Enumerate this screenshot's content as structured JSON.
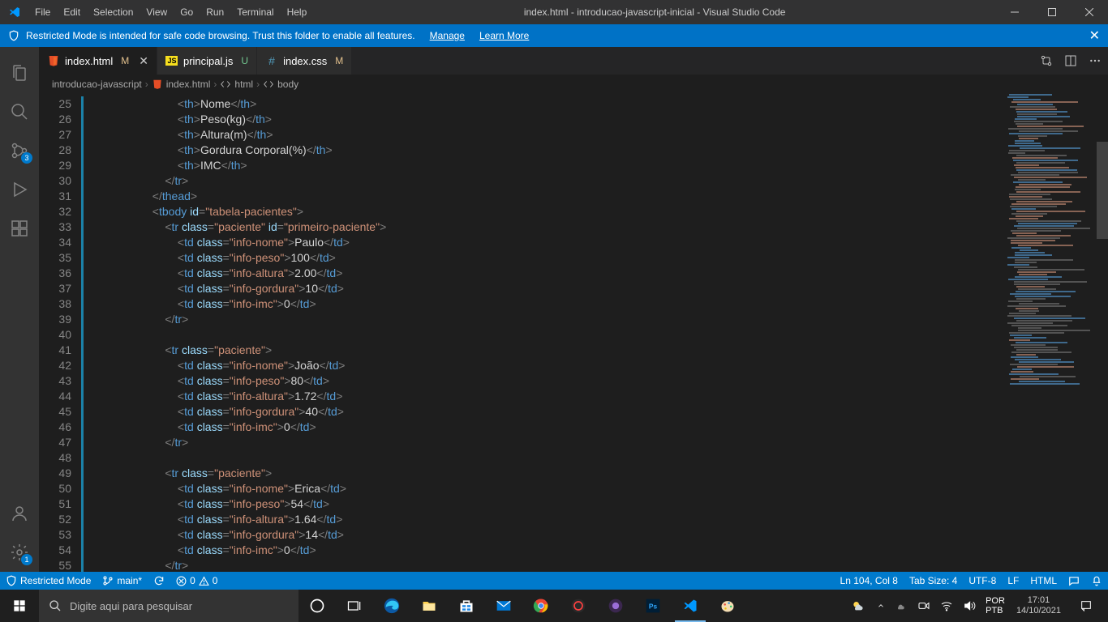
{
  "titlebar": {
    "menus": [
      "File",
      "Edit",
      "Selection",
      "View",
      "Go",
      "Run",
      "Terminal",
      "Help"
    ],
    "title": "index.html - introducao-javascript-inicial - Visual Studio Code"
  },
  "notification": {
    "text": "Restricted Mode is intended for safe code browsing. Trust this folder to enable all features.",
    "manage": "Manage",
    "learn_more": "Learn More"
  },
  "activitybar": {
    "scm_badge": "3",
    "manage_badge": "1"
  },
  "tabs": [
    {
      "icon": "html",
      "label": "index.html",
      "mod": "M",
      "mod_class": "m",
      "active": true,
      "close": true
    },
    {
      "icon": "js",
      "label": "principal.js",
      "mod": "U",
      "mod_class": "u",
      "active": false,
      "close": false
    },
    {
      "icon": "css",
      "label": "index.css",
      "mod": "M",
      "mod_class": "m",
      "active": false,
      "close": false
    }
  ],
  "breadcrumbs": {
    "items": [
      {
        "icon": "",
        "label": "introducao-javascript"
      },
      {
        "icon": "html",
        "label": "index.html"
      },
      {
        "icon": "sym",
        "label": "html"
      },
      {
        "icon": "sym",
        "label": "body"
      }
    ]
  },
  "gutter_start": 25,
  "gutter_end": 55,
  "code_lines": [
    {
      "indent": 7,
      "html": "<span class='t-tag'>&lt;</span><span class='t-elem'>th</span><span class='t-tag'>&gt;</span><span class='t-text'>Nome</span><span class='t-tag'>&lt;/</span><span class='t-elem'>th</span><span class='t-tag'>&gt;</span>",
      "m": true
    },
    {
      "indent": 7,
      "html": "<span class='t-tag'>&lt;</span><span class='t-elem'>th</span><span class='t-tag'>&gt;</span><span class='t-text'>Peso(kg)</span><span class='t-tag'>&lt;/</span><span class='t-elem'>th</span><span class='t-tag'>&gt;</span>",
      "m": true
    },
    {
      "indent": 7,
      "html": "<span class='t-tag'>&lt;</span><span class='t-elem'>th</span><span class='t-tag'>&gt;</span><span class='t-text'>Altura(m)</span><span class='t-tag'>&lt;/</span><span class='t-elem'>th</span><span class='t-tag'>&gt;</span>",
      "m": true
    },
    {
      "indent": 7,
      "html": "<span class='t-tag'>&lt;</span><span class='t-elem'>th</span><span class='t-tag'>&gt;</span><span class='t-text'>Gordura Corporal(%)</span><span class='t-tag'>&lt;/</span><span class='t-elem'>th</span><span class='t-tag'>&gt;</span>",
      "m": true
    },
    {
      "indent": 7,
      "html": "<span class='t-tag'>&lt;</span><span class='t-elem'>th</span><span class='t-tag'>&gt;</span><span class='t-text'>IMC</span><span class='t-tag'>&lt;/</span><span class='t-elem'>th</span><span class='t-tag'>&gt;</span>",
      "m": true
    },
    {
      "indent": 6,
      "html": "<span class='t-tag'>&lt;/</span><span class='t-elem'>tr</span><span class='t-tag'>&gt;</span>",
      "m": true
    },
    {
      "indent": 5,
      "html": "<span class='t-tag'>&lt;/</span><span class='t-elem'>thead</span><span class='t-tag'>&gt;</span>",
      "m": true
    },
    {
      "indent": 5,
      "html": "<span class='t-tag'>&lt;</span><span class='t-elem'>tbody</span> <span class='t-attr'>id</span><span class='t-punct'>=</span><span class='t-str'>\"tabela-pacientes\"</span><span class='t-tag'>&gt;</span>",
      "m": true
    },
    {
      "indent": 6,
      "html": "<span class='t-tag'>&lt;</span><span class='t-elem'>tr</span> <span class='t-attr'>class</span><span class='t-punct'>=</span><span class='t-str'>\"paciente\"</span> <span class='t-attr'>id</span><span class='t-punct'>=</span><span class='t-str'>\"primeiro-paciente\"</span><span class='t-tag'>&gt;</span>",
      "m": true
    },
    {
      "indent": 7,
      "html": "<span class='t-tag'>&lt;</span><span class='t-elem'>td</span> <span class='t-attr'>class</span><span class='t-punct'>=</span><span class='t-str'>\"info-nome\"</span><span class='t-tag'>&gt;</span><span class='t-text'>Paulo</span><span class='t-tag'>&lt;/</span><span class='t-elem'>td</span><span class='t-tag'>&gt;</span>",
      "m": true
    },
    {
      "indent": 7,
      "html": "<span class='t-tag'>&lt;</span><span class='t-elem'>td</span> <span class='t-attr'>class</span><span class='t-punct'>=</span><span class='t-str'>\"info-peso\"</span><span class='t-tag'>&gt;</span><span class='t-text'>100</span><span class='t-tag'>&lt;/</span><span class='t-elem'>td</span><span class='t-tag'>&gt;</span>",
      "m": true
    },
    {
      "indent": 7,
      "html": "<span class='t-tag'>&lt;</span><span class='t-elem'>td</span> <span class='t-attr'>class</span><span class='t-punct'>=</span><span class='t-str'>\"info-altura\"</span><span class='t-tag'>&gt;</span><span class='t-text'>2.00</span><span class='t-tag'>&lt;/</span><span class='t-elem'>td</span><span class='t-tag'>&gt;</span>",
      "m": true
    },
    {
      "indent": 7,
      "html": "<span class='t-tag'>&lt;</span><span class='t-elem'>td</span> <span class='t-attr'>class</span><span class='t-punct'>=</span><span class='t-str'>\"info-gordura\"</span><span class='t-tag'>&gt;</span><span class='t-text'>10</span><span class='t-tag'>&lt;/</span><span class='t-elem'>td</span><span class='t-tag'>&gt;</span>",
      "m": true
    },
    {
      "indent": 7,
      "html": "<span class='t-tag'>&lt;</span><span class='t-elem'>td</span> <span class='t-attr'>class</span><span class='t-punct'>=</span><span class='t-str'>\"info-imc\"</span><span class='t-tag'>&gt;</span><span class='t-text'>0</span><span class='t-tag'>&lt;/</span><span class='t-elem'>td</span><span class='t-tag'>&gt;</span>",
      "m": true
    },
    {
      "indent": 6,
      "html": "<span class='t-tag'>&lt;/</span><span class='t-elem'>tr</span><span class='t-tag'>&gt;</span>",
      "m": true
    },
    {
      "indent": 0,
      "html": "",
      "m": true
    },
    {
      "indent": 6,
      "html": "<span class='t-tag'>&lt;</span><span class='t-elem'>tr</span> <span class='t-attr'>class</span><span class='t-punct'>=</span><span class='t-str'>\"paciente\"</span><span class='t-tag'>&gt;</span>",
      "m": true
    },
    {
      "indent": 7,
      "html": "<span class='t-tag'>&lt;</span><span class='t-elem'>td</span> <span class='t-attr'>class</span><span class='t-punct'>=</span><span class='t-str'>\"info-nome\"</span><span class='t-tag'>&gt;</span><span class='t-text'>João</span><span class='t-tag'>&lt;/</span><span class='t-elem'>td</span><span class='t-tag'>&gt;</span>",
      "m": true
    },
    {
      "indent": 7,
      "html": "<span class='t-tag'>&lt;</span><span class='t-elem'>td</span> <span class='t-attr'>class</span><span class='t-punct'>=</span><span class='t-str'>\"info-peso\"</span><span class='t-tag'>&gt;</span><span class='t-text'>80</span><span class='t-tag'>&lt;/</span><span class='t-elem'>td</span><span class='t-tag'>&gt;</span>",
      "m": true
    },
    {
      "indent": 7,
      "html": "<span class='t-tag'>&lt;</span><span class='t-elem'>td</span> <span class='t-attr'>class</span><span class='t-punct'>=</span><span class='t-str'>\"info-altura\"</span><span class='t-tag'>&gt;</span><span class='t-text'>1.72</span><span class='t-tag'>&lt;/</span><span class='t-elem'>td</span><span class='t-tag'>&gt;</span>",
      "m": true
    },
    {
      "indent": 7,
      "html": "<span class='t-tag'>&lt;</span><span class='t-elem'>td</span> <span class='t-attr'>class</span><span class='t-punct'>=</span><span class='t-str'>\"info-gordura\"</span><span class='t-tag'>&gt;</span><span class='t-text'>40</span><span class='t-tag'>&lt;/</span><span class='t-elem'>td</span><span class='t-tag'>&gt;</span>",
      "m": true
    },
    {
      "indent": 7,
      "html": "<span class='t-tag'>&lt;</span><span class='t-elem'>td</span> <span class='t-attr'>class</span><span class='t-punct'>=</span><span class='t-str'>\"info-imc\"</span><span class='t-tag'>&gt;</span><span class='t-text'>0</span><span class='t-tag'>&lt;/</span><span class='t-elem'>td</span><span class='t-tag'>&gt;</span>",
      "m": true
    },
    {
      "indent": 6,
      "html": "<span class='t-tag'>&lt;/</span><span class='t-elem'>tr</span><span class='t-tag'>&gt;</span>",
      "m": true
    },
    {
      "indent": 0,
      "html": "",
      "m": true
    },
    {
      "indent": 6,
      "html": "<span class='t-tag'>&lt;</span><span class='t-elem'>tr</span> <span class='t-attr'>class</span><span class='t-punct'>=</span><span class='t-str'>\"paciente\"</span><span class='t-tag'>&gt;</span>",
      "m": true
    },
    {
      "indent": 7,
      "html": "<span class='t-tag'>&lt;</span><span class='t-elem'>td</span> <span class='t-attr'>class</span><span class='t-punct'>=</span><span class='t-str'>\"info-nome\"</span><span class='t-tag'>&gt;</span><span class='t-text'>Erica</span><span class='t-tag'>&lt;/</span><span class='t-elem'>td</span><span class='t-tag'>&gt;</span>",
      "m": true
    },
    {
      "indent": 7,
      "html": "<span class='t-tag'>&lt;</span><span class='t-elem'>td</span> <span class='t-attr'>class</span><span class='t-punct'>=</span><span class='t-str'>\"info-peso\"</span><span class='t-tag'>&gt;</span><span class='t-text'>54</span><span class='t-tag'>&lt;/</span><span class='t-elem'>td</span><span class='t-tag'>&gt;</span>",
      "m": true
    },
    {
      "indent": 7,
      "html": "<span class='t-tag'>&lt;</span><span class='t-elem'>td</span> <span class='t-attr'>class</span><span class='t-punct'>=</span><span class='t-str'>\"info-altura\"</span><span class='t-tag'>&gt;</span><span class='t-text'>1.64</span><span class='t-tag'>&lt;/</span><span class='t-elem'>td</span><span class='t-tag'>&gt;</span>",
      "m": true
    },
    {
      "indent": 7,
      "html": "<span class='t-tag'>&lt;</span><span class='t-elem'>td</span> <span class='t-attr'>class</span><span class='t-punct'>=</span><span class='t-str'>\"info-gordura\"</span><span class='t-tag'>&gt;</span><span class='t-text'>14</span><span class='t-tag'>&lt;/</span><span class='t-elem'>td</span><span class='t-tag'>&gt;</span>",
      "m": true
    },
    {
      "indent": 7,
      "html": "<span class='t-tag'>&lt;</span><span class='t-elem'>td</span> <span class='t-attr'>class</span><span class='t-punct'>=</span><span class='t-str'>\"info-imc\"</span><span class='t-tag'>&gt;</span><span class='t-text'>0</span><span class='t-tag'>&lt;/</span><span class='t-elem'>td</span><span class='t-tag'>&gt;</span>",
      "m": true
    },
    {
      "indent": 6,
      "html": "<span class='t-tag'>&lt;/</span><span class='t-elem'>tr</span><span class='t-tag'>&gt;</span>",
      "m": true
    }
  ],
  "statusbar": {
    "restricted": "Restricted Mode",
    "branch": "main*",
    "errors": "0",
    "warnings": "0",
    "lncol": "Ln 104, Col 8",
    "tabsize": "Tab Size: 4",
    "encoding": "UTF-8",
    "eol": "LF",
    "lang": "HTML"
  },
  "taskbar": {
    "search_placeholder": "Digite aqui para pesquisar",
    "time": "17:01",
    "date": "14/10/2021"
  }
}
